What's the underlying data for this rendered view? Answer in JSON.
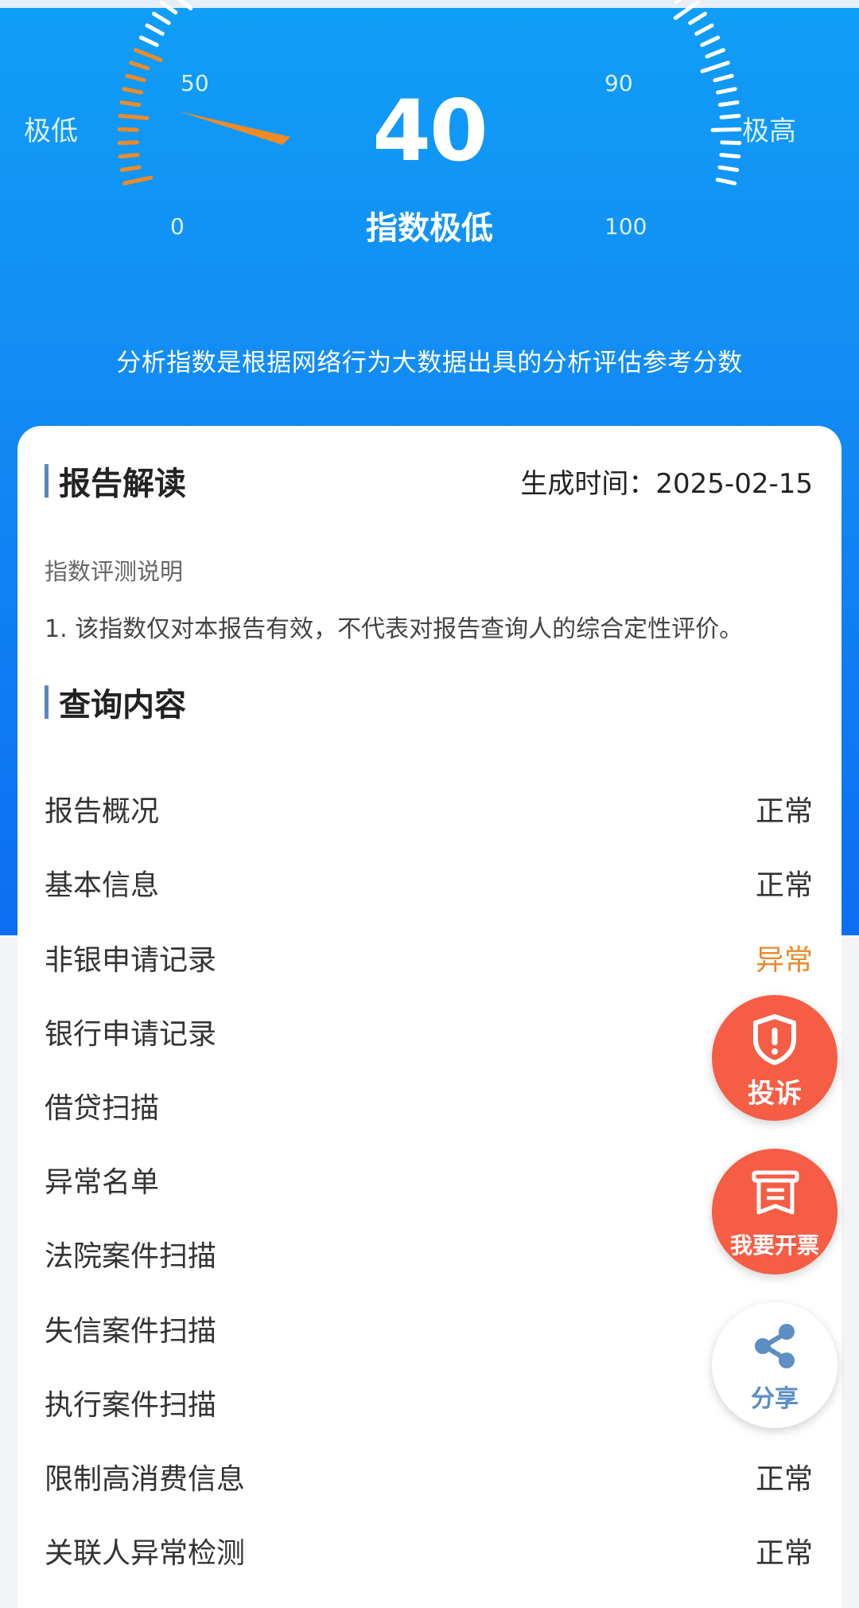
{
  "gauge": {
    "score": "40",
    "score_label": "指数极低",
    "left_label": "极低",
    "right_label": "极高",
    "tick_0": "0",
    "tick_50": "50",
    "tick_90": "90",
    "tick_100": "100",
    "value": 40,
    "accent_color": "#f28a25"
  },
  "description": "分析指数是根据网络行为大数据出具的分析评估参考分数",
  "report": {
    "title": "报告解读",
    "generated_time": "生成时间：2025-02-15",
    "subtitle": "指数评测说明",
    "note": "1. 该指数仅对本报告有效，不代表对报告查询人的综合定性评价。"
  },
  "query": {
    "title": "查询内容",
    "items": [
      {
        "name": "报告概况",
        "status": "正常"
      },
      {
        "name": "基本信息",
        "status": "正常"
      },
      {
        "name": "非银申请记录",
        "status": "异常"
      },
      {
        "name": "银行申请记录",
        "status": ""
      },
      {
        "name": "借贷扫描",
        "status": ""
      },
      {
        "name": "异常名单",
        "status": ""
      },
      {
        "name": "法院案件扫描",
        "status": ""
      },
      {
        "name": "失信案件扫描",
        "status": ""
      },
      {
        "name": "执行案件扫描",
        "status": ""
      },
      {
        "name": "限制高消费信息",
        "status": "正常"
      },
      {
        "name": "关联人异常检测",
        "status": "正常"
      }
    ]
  },
  "fabs": {
    "complaint": "投诉",
    "invoice": "我要开票",
    "share": "分享"
  },
  "colors": {
    "primary_blue": "#128cf5",
    "warn_orange": "#ea8a2c",
    "fab_red": "#f55d44"
  }
}
